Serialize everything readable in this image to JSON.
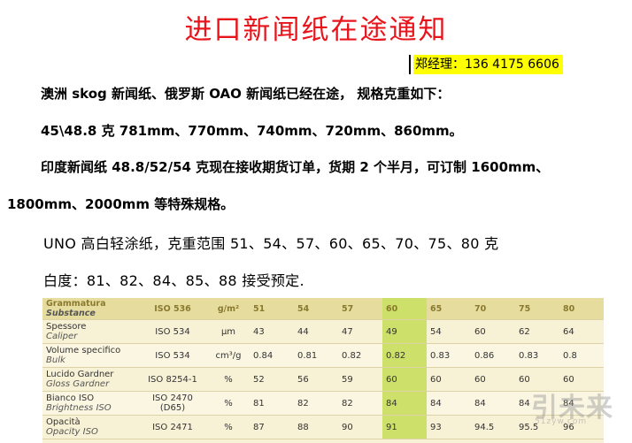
{
  "title": "进口新闻纸在途通知",
  "contact": "郑经理：136 4175 6606",
  "paragraphs": {
    "l1": "澳洲 skog 新闻纸、俄罗斯 OAO 新闻纸已经在途， 规格克重如下：",
    "l2": "45\\48.8 克 781mm、770mm、740mm、720mm、860mm。",
    "l3": "印度新闻纸    48.8/52/54 克现在接收期货订单，货期 2 个半月，可订制 1600mm、",
    "l4": "1800mm、2000mm 等特殊规格。",
    "l5": "UNO 高白轻涂纸，克重范围 51、54、57、60、65、70、75、80 克",
    "l6": "白度：81、82、84、85、88 接受预定."
  },
  "table": {
    "header": {
      "prop": "Grammatura",
      "prop_en": "Substance",
      "std": "ISO 536",
      "unit": "g/m²",
      "values": [
        "51",
        "54",
        "57",
        "60",
        "65",
        "70",
        "75",
        "80"
      ]
    },
    "rows": [
      {
        "prop": "Spessore",
        "prop_en": "Caliper",
        "std": "ISO 534",
        "unit": "μm",
        "values": [
          "43",
          "44",
          "47",
          "49",
          "54",
          "60",
          "62",
          "64"
        ]
      },
      {
        "prop": "Volume specifico",
        "prop_en": "Bulk",
        "std": "ISO 534",
        "unit": "cm³/g",
        "values": [
          "0.84",
          "0.81",
          "0.82",
          "0.82",
          "0.83",
          "0.86",
          "0.83",
          "0.8"
        ]
      },
      {
        "prop": "Lucido Gardner",
        "prop_en": "Gloss Gardner",
        "std": "ISO 8254-1",
        "unit": "%",
        "values": [
          "52",
          "56",
          "59",
          "60",
          "60",
          "60",
          "60",
          "60"
        ]
      },
      {
        "prop": "Bianco ISO",
        "prop_en": "Brightness ISO",
        "std": "ISO 2470 (D65)",
        "unit": "%",
        "values": [
          "81",
          "82",
          "82",
          "84",
          "84",
          "84",
          "84",
          "84"
        ]
      },
      {
        "prop": "Opacità",
        "prop_en": "Opacity ISO",
        "std": "ISO 2471",
        "unit": "%",
        "values": [
          "87",
          "88",
          "90",
          "91",
          "93",
          "94.5",
          "95.5",
          "96"
        ]
      }
    ],
    "highlight_column": 3,
    "highlight_color": "#cde06a"
  },
  "watermark": {
    "text": "引未来",
    "url": "51zyw.com"
  }
}
